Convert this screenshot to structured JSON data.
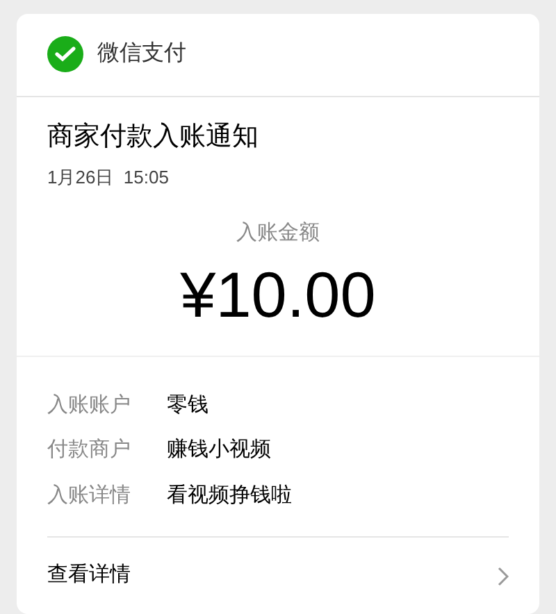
{
  "header": {
    "title": "微信支付"
  },
  "notice": {
    "title": "商家付款入账通知",
    "time": "1月26日  15:05"
  },
  "amount": {
    "label": "入账金额",
    "value": "¥10.00"
  },
  "details": [
    {
      "label": "入账账户",
      "value": "零钱"
    },
    {
      "label": "付款商户",
      "value": "赚钱小视频"
    },
    {
      "label": "入账详情",
      "value": "看视频挣钱啦"
    }
  ],
  "footer": {
    "link": "查看详情"
  }
}
